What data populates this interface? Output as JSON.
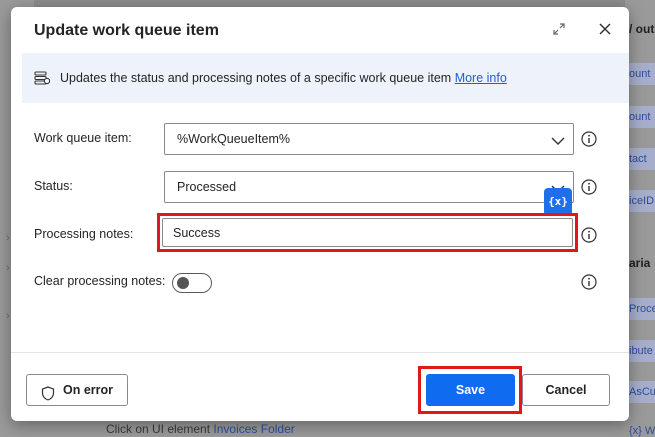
{
  "dialog": {
    "title": "Update work queue item",
    "info_text": "Updates the status and processing notes of a specific work queue item",
    "info_link": "More info"
  },
  "fields": {
    "work_queue_item": {
      "label": "Work queue item:",
      "value": "%WorkQueueItem%"
    },
    "status": {
      "label": "Status:",
      "value": "Processed"
    },
    "processing_notes": {
      "label": "Processing notes:",
      "value": "Success"
    },
    "clear_processing_notes": {
      "label": "Clear processing notes:",
      "on": false
    }
  },
  "variable_button": {
    "label": "{x}"
  },
  "footer": {
    "on_error_label": "On error",
    "save_label": "Save",
    "cancel_label": "Cancel"
  },
  "background": {
    "bottom_text": "Click on UI element",
    "bottom_link": "Invoices Folder",
    "right_fragments": [
      "/ out",
      "ount",
      "ount",
      "tact",
      "iceID",
      "aria",
      "Proce",
      "ibute",
      "AsCu",
      "{x}  WorkQue"
    ]
  },
  "colors": {
    "accent": "#0f6cf0",
    "highlight": "#e01818",
    "info_bar": "#eef3fb",
    "link": "#1f5fcf"
  },
  "icons": [
    "expand-icon",
    "close-icon",
    "queue-icon",
    "chevron-down-icon",
    "help-icon",
    "shield-icon"
  ]
}
